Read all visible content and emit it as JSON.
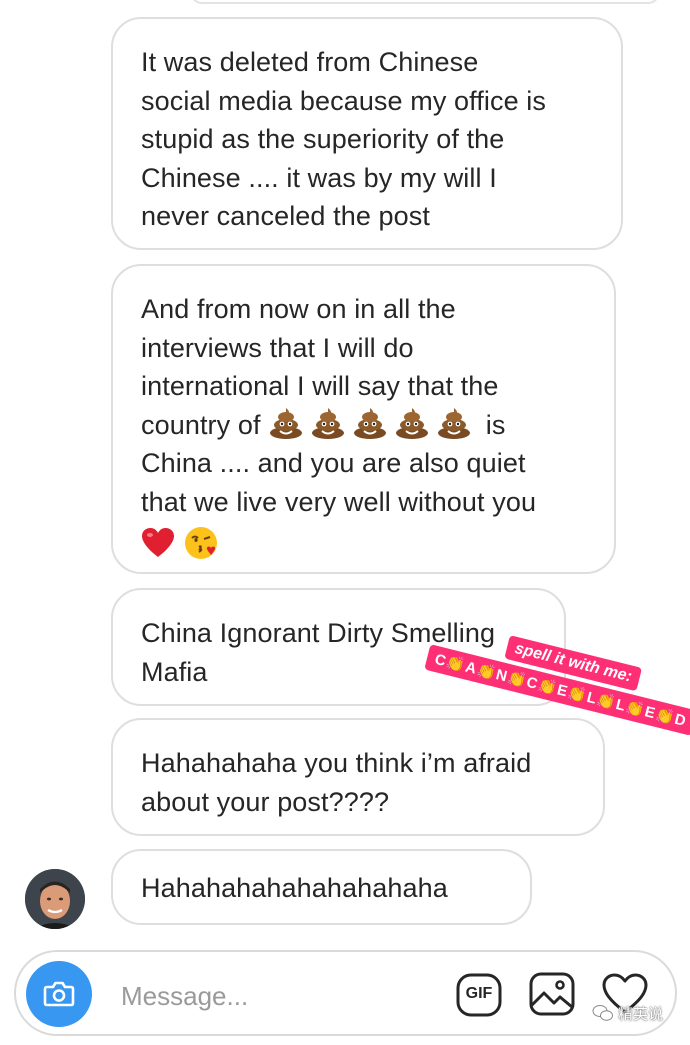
{
  "messages": [
    {
      "text": "It was deleted from Chinese\nsocial media because my office is\nstupid as the superiority of the\nChinese .... it was by my will I\nnever canceled the post"
    },
    {
      "text_before": "And from now on in all the\ninterviews that I will do\ninternational I will say that the\ncountry of ",
      "emoji_run": "poop-emoji x5",
      "text_after": " is\nChina .... and you are also quiet\nthat we live very well without you",
      "emoji_end": [
        "red-heart-emoji",
        "kissing-face-emoji"
      ]
    },
    {
      "text": "China Ignorant Dirty Smelling\nMafia"
    },
    {
      "text": "Hahahahaha you think i’m afraid\nabout your post????"
    },
    {
      "text": "Hahahahahahahahahaha"
    }
  ],
  "sticker": {
    "line1": "spell it with me:",
    "line2": "C👏A👏N👏C👏E👏L👏L👏E👏D",
    "color": "#ff2f76"
  },
  "composer": {
    "placeholder": "Message...",
    "gif_label": "GIF",
    "accent": "#3897f0",
    "icons": [
      "camera-icon",
      "gif-icon",
      "gallery-icon",
      "heart-icon"
    ]
  },
  "watermark": {
    "text": "精英说"
  }
}
